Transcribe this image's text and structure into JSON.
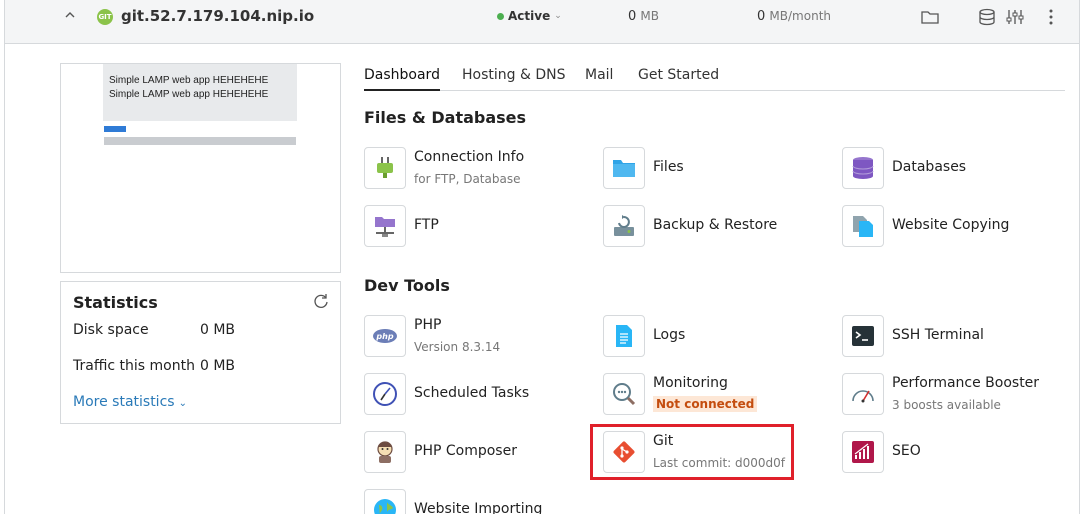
{
  "domain": {
    "badge": "GIT",
    "name": "git.52.7.179.104.nip.io",
    "status": "Active",
    "disk_value": "0",
    "disk_unit": "MB",
    "traffic_value": "0",
    "traffic_unit": "MB/month"
  },
  "preview": {
    "line1": "Simple LAMP web app HEHEHEHE",
    "line2": "Simple LAMP web app HEHEHEHE"
  },
  "statistics": {
    "title": "Statistics",
    "disk_label": "Disk space",
    "disk_value": "0 MB",
    "traffic_label": "Traffic this month",
    "traffic_value": "0 MB",
    "more_link": "More statistics"
  },
  "tabs": [
    {
      "label": "Dashboard",
      "active": true
    },
    {
      "label": "Hosting & DNS",
      "active": false
    },
    {
      "label": "Mail",
      "active": false
    },
    {
      "label": "Get Started",
      "active": false
    }
  ],
  "sections": {
    "files": "Files & Databases",
    "dev": "Dev Tools"
  },
  "files_tools": [
    {
      "name": "Connection Info",
      "sub": "for FTP, Database",
      "icon": "plug-icon"
    },
    {
      "name": "Files",
      "icon": "folder-icon"
    },
    {
      "name": "Databases",
      "icon": "database-icon"
    },
    {
      "name": "FTP",
      "icon": "ftp-icon"
    },
    {
      "name": "Backup & Restore",
      "icon": "backup-icon"
    },
    {
      "name": "Website Copying",
      "icon": "copy-icon"
    }
  ],
  "dev_tools": [
    {
      "name": "PHP",
      "sub": "Version 8.3.14",
      "icon": "php-icon"
    },
    {
      "name": "Logs",
      "icon": "logs-icon"
    },
    {
      "name": "SSH Terminal",
      "icon": "terminal-icon"
    },
    {
      "name": "Scheduled Tasks",
      "icon": "clock-icon"
    },
    {
      "name": "Monitoring",
      "badge": "Not connected",
      "icon": "monitoring-icon"
    },
    {
      "name": "Performance Booster",
      "sub": "3 boosts available",
      "icon": "gauge-icon"
    },
    {
      "name": "PHP Composer",
      "icon": "composer-icon"
    },
    {
      "name": "Git",
      "sub": "Last commit: d000d0f",
      "icon": "git-icon"
    },
    {
      "name": "SEO",
      "icon": "seo-icon"
    },
    {
      "name": "Website Importing",
      "icon": "globe-icon"
    }
  ],
  "colors": {
    "accent_link": "#2a7ab8",
    "active_dot": "#4caf50",
    "highlight": "#e0202a",
    "warning_badge": "#c44d0f"
  }
}
